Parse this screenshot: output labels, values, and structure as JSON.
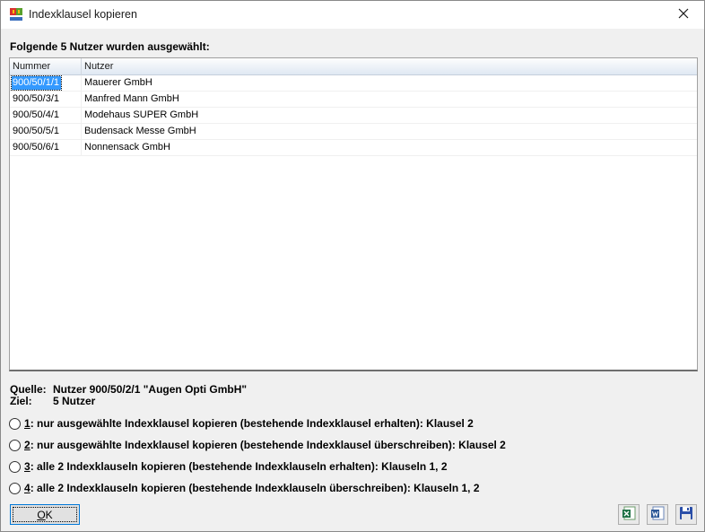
{
  "window": {
    "title": "Indexklausel kopieren"
  },
  "heading": "Folgende 5 Nutzer wurden ausgewählt:",
  "list": {
    "columns": [
      "Nummer",
      "Nutzer"
    ],
    "rows": [
      {
        "nummer": "900/50/1/1",
        "nutzer": "Mauerer GmbH",
        "selected": true
      },
      {
        "nummer": "900/50/3/1",
        "nutzer": "Manfred Mann GmbH",
        "selected": false
      },
      {
        "nummer": "900/50/4/1",
        "nutzer": "Modehaus SUPER GmbH",
        "selected": false
      },
      {
        "nummer": "900/50/5/1",
        "nutzer": "Budensack Messe GmbH",
        "selected": false
      },
      {
        "nummer": "900/50/6/1",
        "nutzer": "Nonnensack GmbH",
        "selected": false
      }
    ]
  },
  "info": {
    "source_label": "Quelle:",
    "source_value": "Nutzer 900/50/2/1 \"Augen Opti GmbH\"",
    "target_label": "Ziel:",
    "target_value": "5 Nutzer"
  },
  "options": [
    {
      "key": "1",
      "text": ": nur ausgewählte Indexklausel kopieren (bestehende Indexklausel erhalten): Klausel 2"
    },
    {
      "key": "2",
      "text": ": nur ausgewählte Indexklausel kopieren (bestehende Indexklausel überschreiben): Klausel 2"
    },
    {
      "key": "3",
      "text": ": alle 2 Indexklauseln kopieren (bestehende Indexklauseln erhalten): Klauseln 1, 2"
    },
    {
      "key": "4",
      "text": ": alle 2 Indexklauseln kopieren (bestehende Indexklauseln überschreiben): Klauseln 1, 2"
    }
  ],
  "buttons": {
    "ok_key": "O",
    "ok_rest": "K"
  },
  "icons": {
    "app": "app-logo-icon",
    "close": "close-icon",
    "excel": "excel-export-icon",
    "word": "word-export-icon",
    "save": "save-icon"
  },
  "colors": {
    "selection": "#3399ff",
    "focus_border": "#0078d7"
  }
}
